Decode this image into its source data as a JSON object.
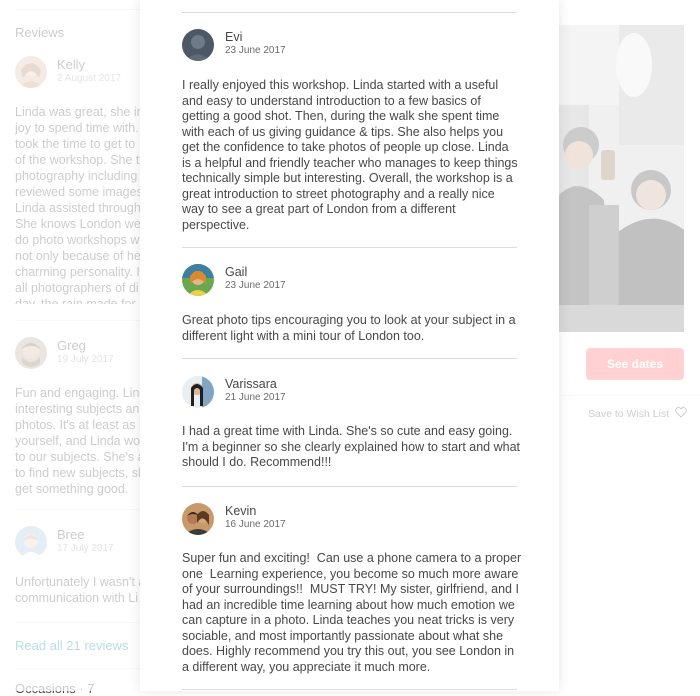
{
  "background": {
    "reviews_heading": "Reviews",
    "reviews": [
      {
        "name": "Kelly",
        "date": "2 August 2017",
        "text": "Linda was great, she in\njoy to spend time with.\ntook the time to get to\nof the workshop. She t\nphotography including\nreviewed some images\nLinda assisted through\nShe knows London we\ndo photo workshops w\nnot only because of he\ncharming personality. I\nall photographers of di\nday, the rain made for"
      },
      {
        "name": "Greg",
        "date": "19 July 2017",
        "text": "Fun and engaging. Lind\ninteresting subjects and\nphotos. It's at least as h\nyourself, and Linda wor\nto our subjects. She's a\nto find new subjects, sl\nget something good."
      },
      {
        "name": "Bree",
        "date": "17 July 2017",
        "text": "Unfortunately I wasn't a\ncommunication with Li"
      }
    ],
    "read_all": "Read all 21 reviews",
    "bottom_partial": "Occasions  ·  7",
    "see_dates": "See dates",
    "wishlist": "Save to Wish List"
  },
  "modal": {
    "reviews": [
      {
        "name": "Evi",
        "date": "23 June 2017",
        "text": "I really enjoyed this workshop. Linda started with a useful\nand easy to understand introduction to a few basics of\ngetting a good shot. Then, during the walk she spent time\nwith each of us giving guidance & tips. She also helps you\nget the confidence to take photos of people up close. Linda\nis a helpful and friendly teacher who manages to keep things\ntechnically simple but interesting. Overall, the workshop is a\ngreat introduction to street photography and a really nice\nway to see a great part of London from a different\nperspective."
      },
      {
        "name": "Gail",
        "date": "23 June 2017",
        "text": "Great photo tips encouraging you to look at your subject in a\ndifferent light with a mini tour of London too."
      },
      {
        "name": "Varissara",
        "date": "21 June 2017",
        "text": "I had a great time with Linda. She's so cute and easy going.\nI'm a beginner so she clearly explained how to start and what\nshould I do. Recommend!!!"
      },
      {
        "name": "Kevin",
        "date": "16 June 2017",
        "text": "Super fun and exciting!  Can use a phone camera to a proper\none  Learning experience, you become so much more aware\nof your surroundings!!  MUST TRY! My sister, girlfriend, and I\nhad an incredible time learning about how much emotion we\ncan capture in a photo. Linda teaches you neat tricks is very\nsociable, and most importantly passionate about what she\ndoes. Highly recommend you try this out, you see London in\na different way, you appreciate it much more."
      }
    ]
  }
}
